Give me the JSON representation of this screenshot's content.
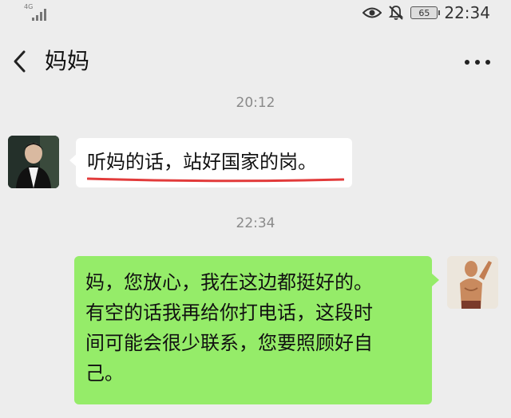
{
  "status_bar": {
    "network": "4G",
    "battery": "65",
    "time": "22:34",
    "icons": [
      "signal-icon",
      "eye-icon",
      "mute-bell-icon",
      "battery-icon"
    ]
  },
  "nav": {
    "back_icon": "chevron-left-icon",
    "title": "妈妈",
    "more_icon": "more-dots-icon"
  },
  "messages": [
    {
      "timestamp": "20:12",
      "direction": "incoming",
      "text": "听妈的话，站好国家的岗。",
      "underline_color": "#e23b3b"
    },
    {
      "timestamp": "22:34",
      "direction": "outgoing",
      "lines": [
        "妈，您放心，我在这边都挺好的。",
        "有空的话我再给你打电话，这段时",
        "间可能会很少联系，您要照顾好自",
        "己。"
      ]
    }
  ],
  "colors": {
    "background": "#ededed",
    "outgoing_bubble": "#95ec69",
    "incoming_bubble": "#ffffff"
  }
}
